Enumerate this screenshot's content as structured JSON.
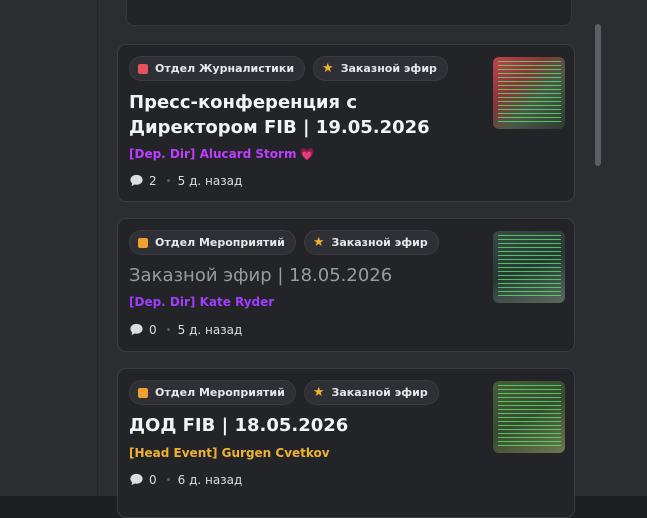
{
  "posts": [
    {
      "tags": [
        {
          "label": "Отдел Журналистики",
          "icon": "red-square-icon",
          "color": "#e8525a"
        },
        {
          "label": "Заказной эфир",
          "icon": "star-icon",
          "color": "#f0b232"
        }
      ],
      "title": "Пресс-конференция с Директором FIB | 19.05.2026",
      "author": "[Dep. Dir] Alucard Storm",
      "author_color": "#c03cff",
      "author_emoji": "💗",
      "replies": "2",
      "time": "5 д. назад"
    },
    {
      "tags": [
        {
          "label": "Отдел Мероприятий",
          "icon": "orange-square-icon",
          "color": "#f0a030"
        },
        {
          "label": "Заказной эфир",
          "icon": "star-icon",
          "color": "#f0b232"
        }
      ],
      "title": "Заказной эфир | 18.05.2026",
      "author": "[Dep. Dir] Kate Ryder",
      "author_color": "#a23cff",
      "replies": "0",
      "time": "5 д. назад"
    },
    {
      "tags": [
        {
          "label": "Отдел Мероприятий",
          "icon": "orange-square-icon",
          "color": "#f0a030"
        },
        {
          "label": "Заказной эфир",
          "icon": "star-icon",
          "color": "#f0b232"
        }
      ],
      "title": "ДОД FIB | 18.05.2026",
      "author": "[Head Event] Gurgen Cvetkov",
      "author_color": "#f0b232",
      "replies": "0",
      "time": "6 д. назад"
    }
  ]
}
